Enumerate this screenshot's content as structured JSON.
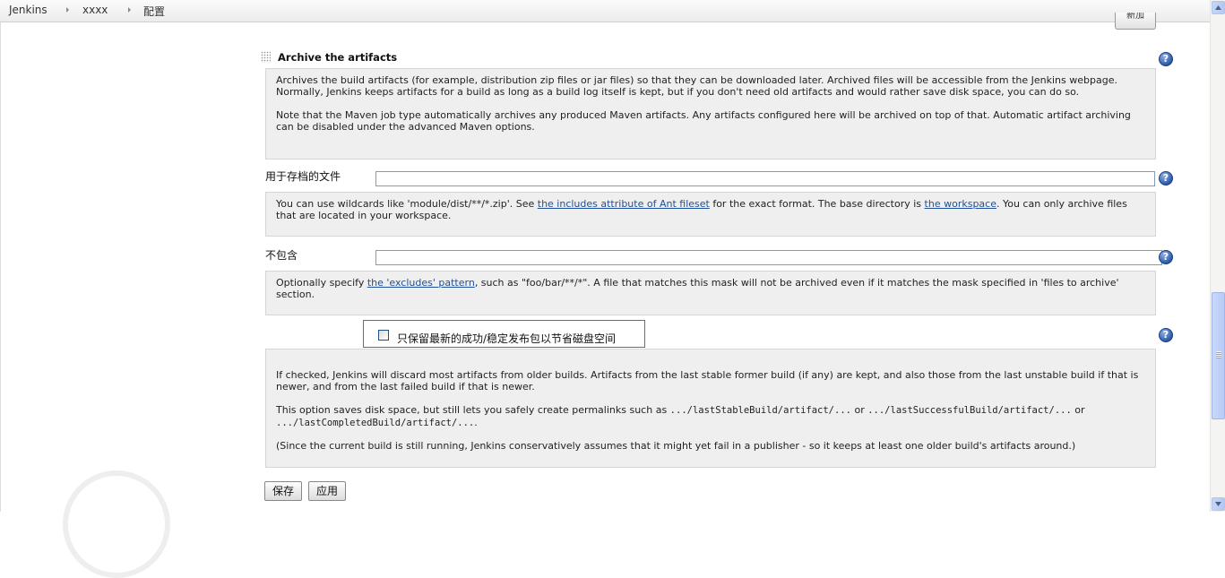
{
  "breadcrumb": {
    "items": [
      "Jenkins",
      "xxxx",
      "配置"
    ]
  },
  "top_button_label": "新加",
  "section": {
    "title": "Archive the artifacts",
    "help_text_p1": "Archives the build artifacts (for example, distribution zip files or jar files) so that they can be downloaded later. Archived files will be accessible from the Jenkins webpage.",
    "help_text_p1b": "Normally, Jenkins keeps artifacts for a build as long as a build log itself is kept, but if you don't need old artifacts and would rather save disk space, you can do so.",
    "help_text_p2": "Note that the Maven job type automatically archives any produced Maven artifacts. Any artifacts configured here will be archived on top of that. Automatic artifact archiving can be disabled under the advanced Maven options."
  },
  "files_field": {
    "label": "用于存档的文件",
    "value": "",
    "help_pre": "You can use wildcards like 'module/dist/**/*.zip'. See ",
    "help_link1": "the includes attribute of Ant fileset",
    "help_mid": " for the exact format. The base directory is ",
    "help_link2": "the workspace",
    "help_post": ". You can only archive files that are located in your workspace."
  },
  "excludes_field": {
    "label": "不包含",
    "value": "",
    "help_pre": "Optionally specify ",
    "help_link": "the 'excludes' pattern",
    "help_post": ", such as \"foo/bar/**/*\". A file that matches this mask will not be archived even if it matches the mask specified in 'files to archive' section."
  },
  "keep_latest": {
    "label": "只保留最新的成功/稳定发布包以节省磁盘空间",
    "checked": false,
    "help_p1": "If checked, Jenkins will discard most artifacts from older builds. Artifacts from the last stable former build (if any) are kept, and also those from the last unstable build if that is newer, and from the last failed build if that is newer.",
    "help_p2_pre": "This option saves disk space, but still lets you safely create permalinks such as ",
    "help_p2_code1": ".../lastStableBuild/artifact/...",
    "help_p2_or1": " or ",
    "help_p2_code2": ".../lastSuccessfulBuild/artifact/...",
    "help_p2_or2": " or ",
    "help_p2_code3": ".../lastCompletedBuild/artifact/...",
    "help_p2_end": ".",
    "help_p3": "(Since the current build is still running, Jenkins conservatively assumes that it might yet fail in a publisher - so it keeps at least one older build's artifacts around.)"
  },
  "buttons": {
    "save": "保存",
    "apply": "应用"
  },
  "help_icon_glyph": "?",
  "colors": {
    "highlight_border": "#e23a3a",
    "link": "#1f4f99",
    "help_background": "#efefef"
  }
}
